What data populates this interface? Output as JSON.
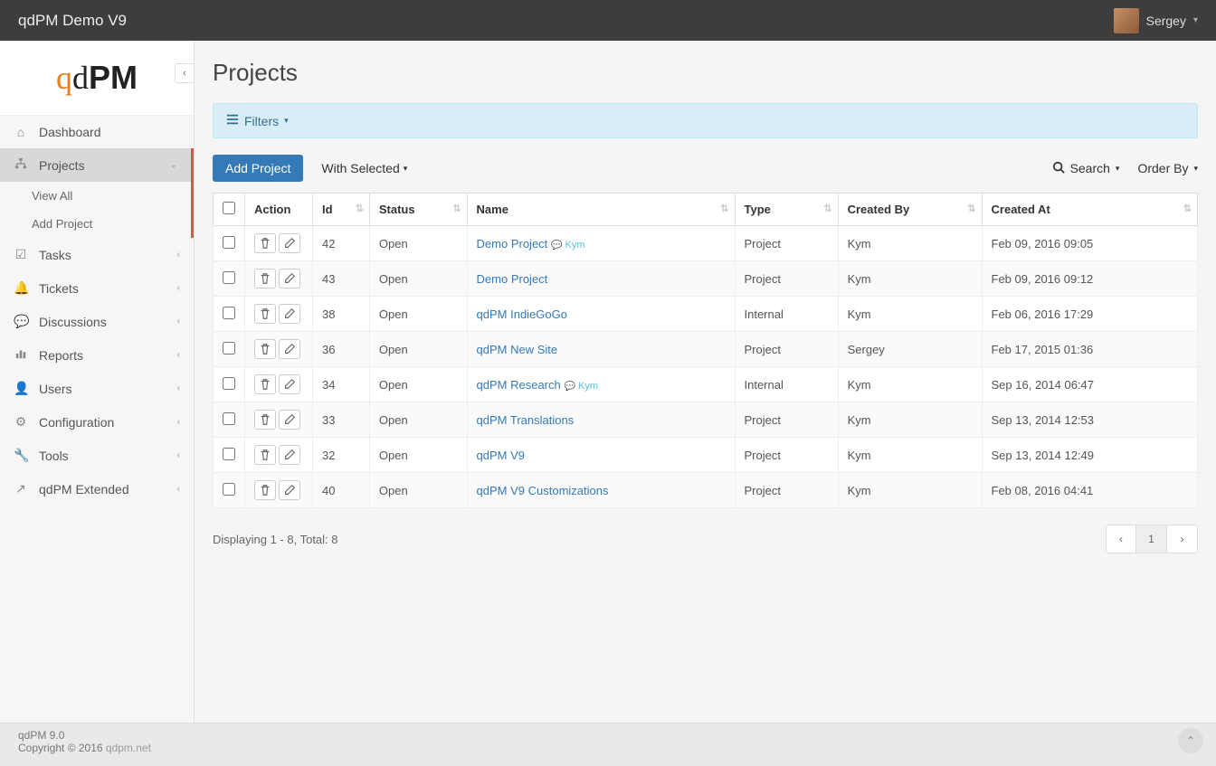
{
  "header": {
    "app_name": "qdPM Demo V9",
    "user_name": "Sergey"
  },
  "logo": {
    "q": "q",
    "d": "d",
    "pm": "PM"
  },
  "sidebar": {
    "items": [
      {
        "label": "Dashboard",
        "icon": "home"
      },
      {
        "label": "Projects",
        "icon": "sitemap",
        "active": true,
        "expanded": true
      },
      {
        "label": "Tasks",
        "icon": "check-list"
      },
      {
        "label": "Tickets",
        "icon": "bell"
      },
      {
        "label": "Discussions",
        "icon": "comments"
      },
      {
        "label": "Reports",
        "icon": "bar-chart"
      },
      {
        "label": "Users",
        "icon": "user"
      },
      {
        "label": "Configuration",
        "icon": "gear"
      },
      {
        "label": "Tools",
        "icon": "wrench"
      },
      {
        "label": "qdPM Extended",
        "icon": "external"
      }
    ],
    "subitems": [
      {
        "label": "View All"
      },
      {
        "label": "Add Project"
      }
    ]
  },
  "page": {
    "title": "Projects",
    "filters_label": "Filters",
    "add_button": "Add Project",
    "with_selected": "With Selected",
    "search": "Search",
    "order_by": "Order By"
  },
  "table": {
    "headers": {
      "action": "Action",
      "id": "Id",
      "status": "Status",
      "name": "Name",
      "type": "Type",
      "created_by": "Created By",
      "created_at": "Created At"
    },
    "rows": [
      {
        "id": "42",
        "status": "Open",
        "name": "Demo Project",
        "annot": "Kym",
        "type": "Project",
        "created_by": "Kym",
        "created_at": "Feb 09, 2016 09:05"
      },
      {
        "id": "43",
        "status": "Open",
        "name": "Demo Project",
        "annot": "",
        "type": "Project",
        "created_by": "Kym",
        "created_at": "Feb 09, 2016 09:12"
      },
      {
        "id": "38",
        "status": "Open",
        "name": "qdPM IndieGoGo",
        "annot": "",
        "type": "Internal",
        "created_by": "Kym",
        "created_at": "Feb 06, 2016 17:29"
      },
      {
        "id": "36",
        "status": "Open",
        "name": "qdPM New Site",
        "annot": "",
        "type": "Project",
        "created_by": "Sergey",
        "created_at": "Feb 17, 2015 01:36"
      },
      {
        "id": "34",
        "status": "Open",
        "name": "qdPM Research",
        "annot": "Kym",
        "type": "Internal",
        "created_by": "Kym",
        "created_at": "Sep 16, 2014 06:47"
      },
      {
        "id": "33",
        "status": "Open",
        "name": "qdPM Translations",
        "annot": "",
        "type": "Project",
        "created_by": "Kym",
        "created_at": "Sep 13, 2014 12:53"
      },
      {
        "id": "32",
        "status": "Open",
        "name": "qdPM V9",
        "annot": "",
        "type": "Project",
        "created_by": "Kym",
        "created_at": "Sep 13, 2014 12:49"
      },
      {
        "id": "40",
        "status": "Open",
        "name": "qdPM V9 Customizations",
        "annot": "",
        "type": "Project",
        "created_by": "Kym",
        "created_at": "Feb 08, 2016 04:41"
      }
    ]
  },
  "pagination": {
    "display_text": "Displaying 1 - 8, Total: 8",
    "current": "1"
  },
  "footer": {
    "line1": "qdPM 9.0",
    "line2_prefix": "Copyright © 2016 ",
    "line2_link": "qdpm.net"
  }
}
